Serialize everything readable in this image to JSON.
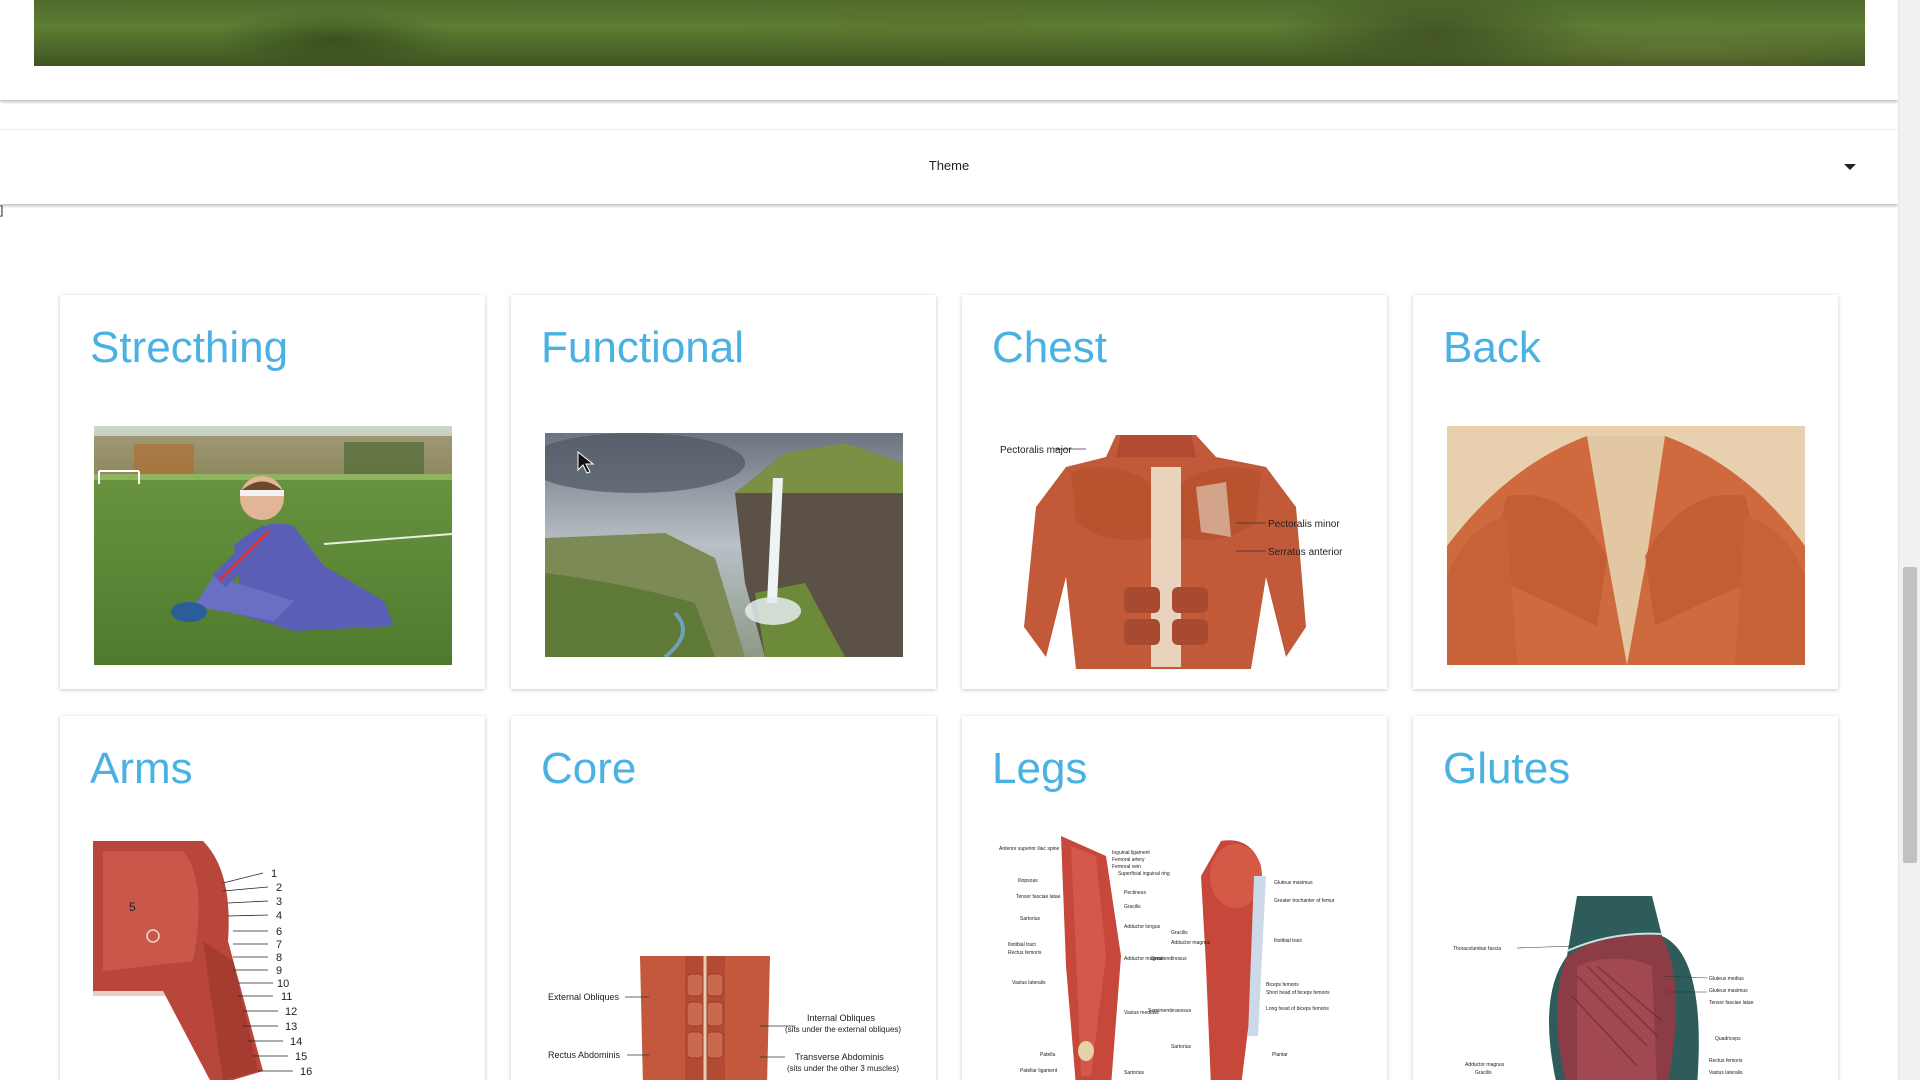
{
  "theme_selector": {
    "label": "Theme",
    "icon": "caret-down-icon"
  },
  "stray_text": "]",
  "categories": [
    {
      "title": "Strecthing",
      "image": "stretching-photo"
    },
    {
      "title": "Functional",
      "image": "waterfall-photo"
    },
    {
      "title": "Chest",
      "image": "chest-anatomy"
    },
    {
      "title": "Back",
      "image": "back-anatomy"
    },
    {
      "title": "Arms",
      "image": "arm-anatomy"
    },
    {
      "title": "Core",
      "image": "core-anatomy"
    },
    {
      "title": "Legs",
      "image": "leg-anatomy"
    },
    {
      "title": "Glutes",
      "image": "glutes-anatomy"
    }
  ],
  "chest_labels": {
    "pectoralis_major": "Pectoralis major",
    "pectoralis_minor": "Pectoralis minor",
    "serratus_anterior": "Serratus anterior"
  },
  "arm_numbers": [
    "1",
    "2",
    "3",
    "4",
    "6",
    "7",
    "8",
    "9",
    "10",
    "11",
    "12",
    "13",
    "14",
    "15",
    "16"
  ],
  "arm_region_label": "5",
  "core_labels": {
    "external_obliques": "External Obliques",
    "rectus_abdominis": "Rectus Abdominis",
    "internal_obliques": "Internal Obliques",
    "internal_obliques_note": "(sits under the external obliques)",
    "transverse_abdominis": "Transverse Abdominis",
    "transverse_abdominis_note": "(sits under the other 3 muscles)"
  },
  "leg_labels": {
    "left": [
      "Anterior superior iliac spine",
      "Iliopsoas",
      "Tensor fasciae latae",
      "Sartorius",
      "Iliotibial tract",
      "Rectus femoris",
      "Vastus lateralis",
      "Patella",
      "Patellar ligament"
    ],
    "right_front": [
      "Inguinal ligament",
      "Femoral artery",
      "Femoral vein",
      "Superficial inguinal ring",
      "Pectineus",
      "Gracilis",
      "Adductor longus",
      "Adductor magnus",
      "Vastus medialis",
      "Sartorius"
    ],
    "back_left": [
      "Gracilis",
      "Adductor magnus",
      "Semitendinosus",
      "Semimembranosus",
      "Sartorius"
    ],
    "back_right": [
      "Gluteus maximus",
      "Greater trochanter of femur",
      "Iliotibial tract",
      "Biceps femoris",
      "Short head of biceps femoris",
      "Long head of biceps femoris",
      "Plantar"
    ]
  },
  "glutes_labels": {
    "left": [
      "Thoracolumbar fascia",
      "Adductor magnus",
      "Gracilis"
    ],
    "right": [
      "Gluteus medius",
      "Gluteus maximus",
      "Tensor fasciae latae",
      "Quadriceps",
      "Rectus femoris",
      "Vastus lateralis"
    ]
  },
  "colors": {
    "title_blue": "#4ab2e3",
    "muscle_red": "#b5432b",
    "skin": "#e8c9a8"
  }
}
